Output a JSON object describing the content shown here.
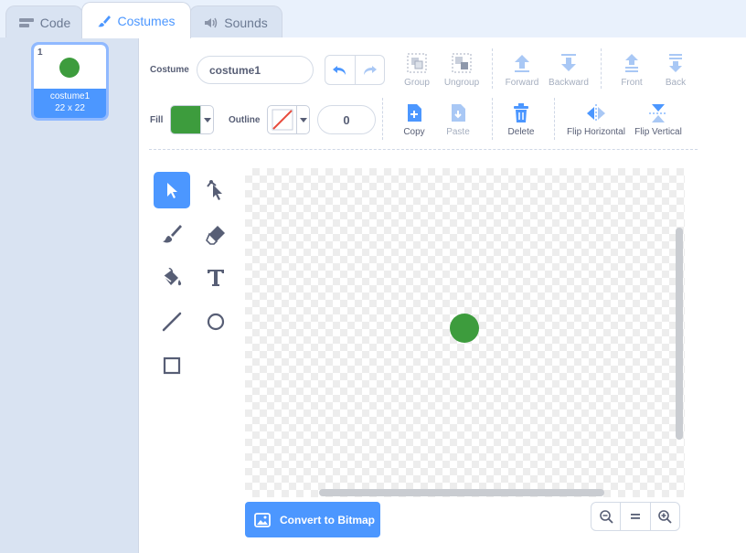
{
  "tabs": [
    {
      "label": "Code",
      "icon": "code-icon"
    },
    {
      "label": "Costumes",
      "icon": "brush-icon"
    },
    {
      "label": "Sounds",
      "icon": "speaker-icon"
    }
  ],
  "costume_list": {
    "items": [
      {
        "number": "1",
        "name": "costume1",
        "size": "22 x 22",
        "shape_color": "#3d9c3d"
      }
    ]
  },
  "editor": {
    "costume_label": "Costume",
    "costume_name": "costume1",
    "fill_label": "Fill",
    "fill_color": "#3d9c3d",
    "outline_label": "Outline",
    "outline_color": "none",
    "outline_width": "0",
    "buttons": {
      "group": "Group",
      "ungroup": "Ungroup",
      "forward": "Forward",
      "backward": "Backward",
      "front": "Front",
      "back": "Back",
      "copy": "Copy",
      "paste": "Paste",
      "delete": "Delete",
      "flip_horizontal": "Flip Horizontal",
      "flip_vertical": "Flip Vertical"
    },
    "convert_label": "Convert to Bitmap",
    "accent_color": "#4c97ff"
  }
}
